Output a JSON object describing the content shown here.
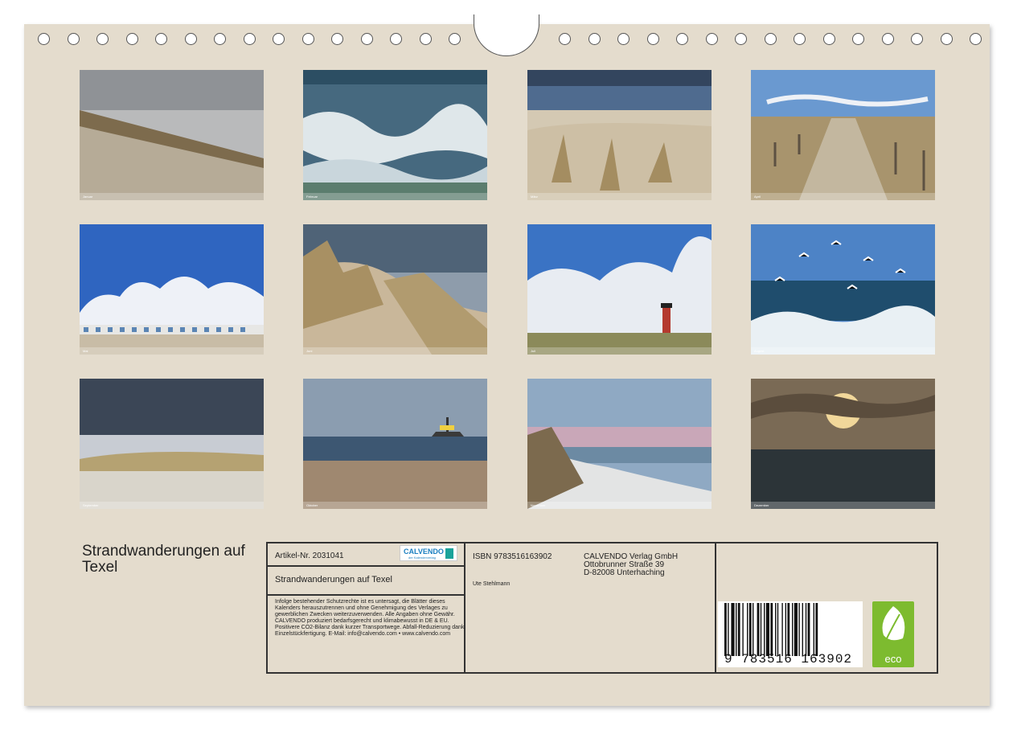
{
  "calendar": {
    "title": "Strandwanderungen auf Texel"
  },
  "months": [
    {
      "name": "Januar",
      "scene": "dune"
    },
    {
      "name": "Februar",
      "scene": "waves"
    },
    {
      "name": "März",
      "scene": "grass-dune"
    },
    {
      "name": "April",
      "scene": "fence-path"
    },
    {
      "name": "Mai",
      "scene": "beach-huts"
    },
    {
      "name": "Juni",
      "scene": "marram-grass"
    },
    {
      "name": "Juli",
      "scene": "lighthouse"
    },
    {
      "name": "August",
      "scene": "seagulls"
    },
    {
      "name": "September",
      "scene": "storm-dune"
    },
    {
      "name": "Oktober",
      "scene": "ship-beach"
    },
    {
      "name": "November",
      "scene": "evening-dune"
    },
    {
      "name": "Dezember",
      "scene": "sunset"
    }
  ],
  "info": {
    "article": "Artikel-Nr. 2031041",
    "logo_text": "CALVENDO",
    "logo_sub": "der Kalenderverlag",
    "subtitle": "Strandwanderungen auf Texel",
    "legal": "Infolge bestehender Schutzrechte ist es untersagt, die Blätter dieses Kalenders herauszutrennen und ohne Genehmigung des Verlages zu gewerblichen Zwecken weiterzuverwenden. Alle Angaben ohne Gewähr. CALVENDO produziert bedarfsgerecht und klimabewusst in DE & EU. Positivere CO2-Bilanz dank kurzer Transportwege. Abfall-Reduzierung dank Einzelstückfertigung. E-Mail: info@calvendo.com • www.calvendo.com",
    "isbn": "ISBN 9783516163902",
    "author": "Ute Stehlmann",
    "publisher": [
      "CALVENDO Verlag GmbH",
      "Ottobrunner Straße 39",
      "D-82008 Unterhaching"
    ],
    "barcode_digits": "9 783516 163902",
    "eco_label": "eco"
  },
  "colors": {
    "page": "#e4dccd",
    "border": "#333333",
    "eco": "#7dbb2f"
  }
}
